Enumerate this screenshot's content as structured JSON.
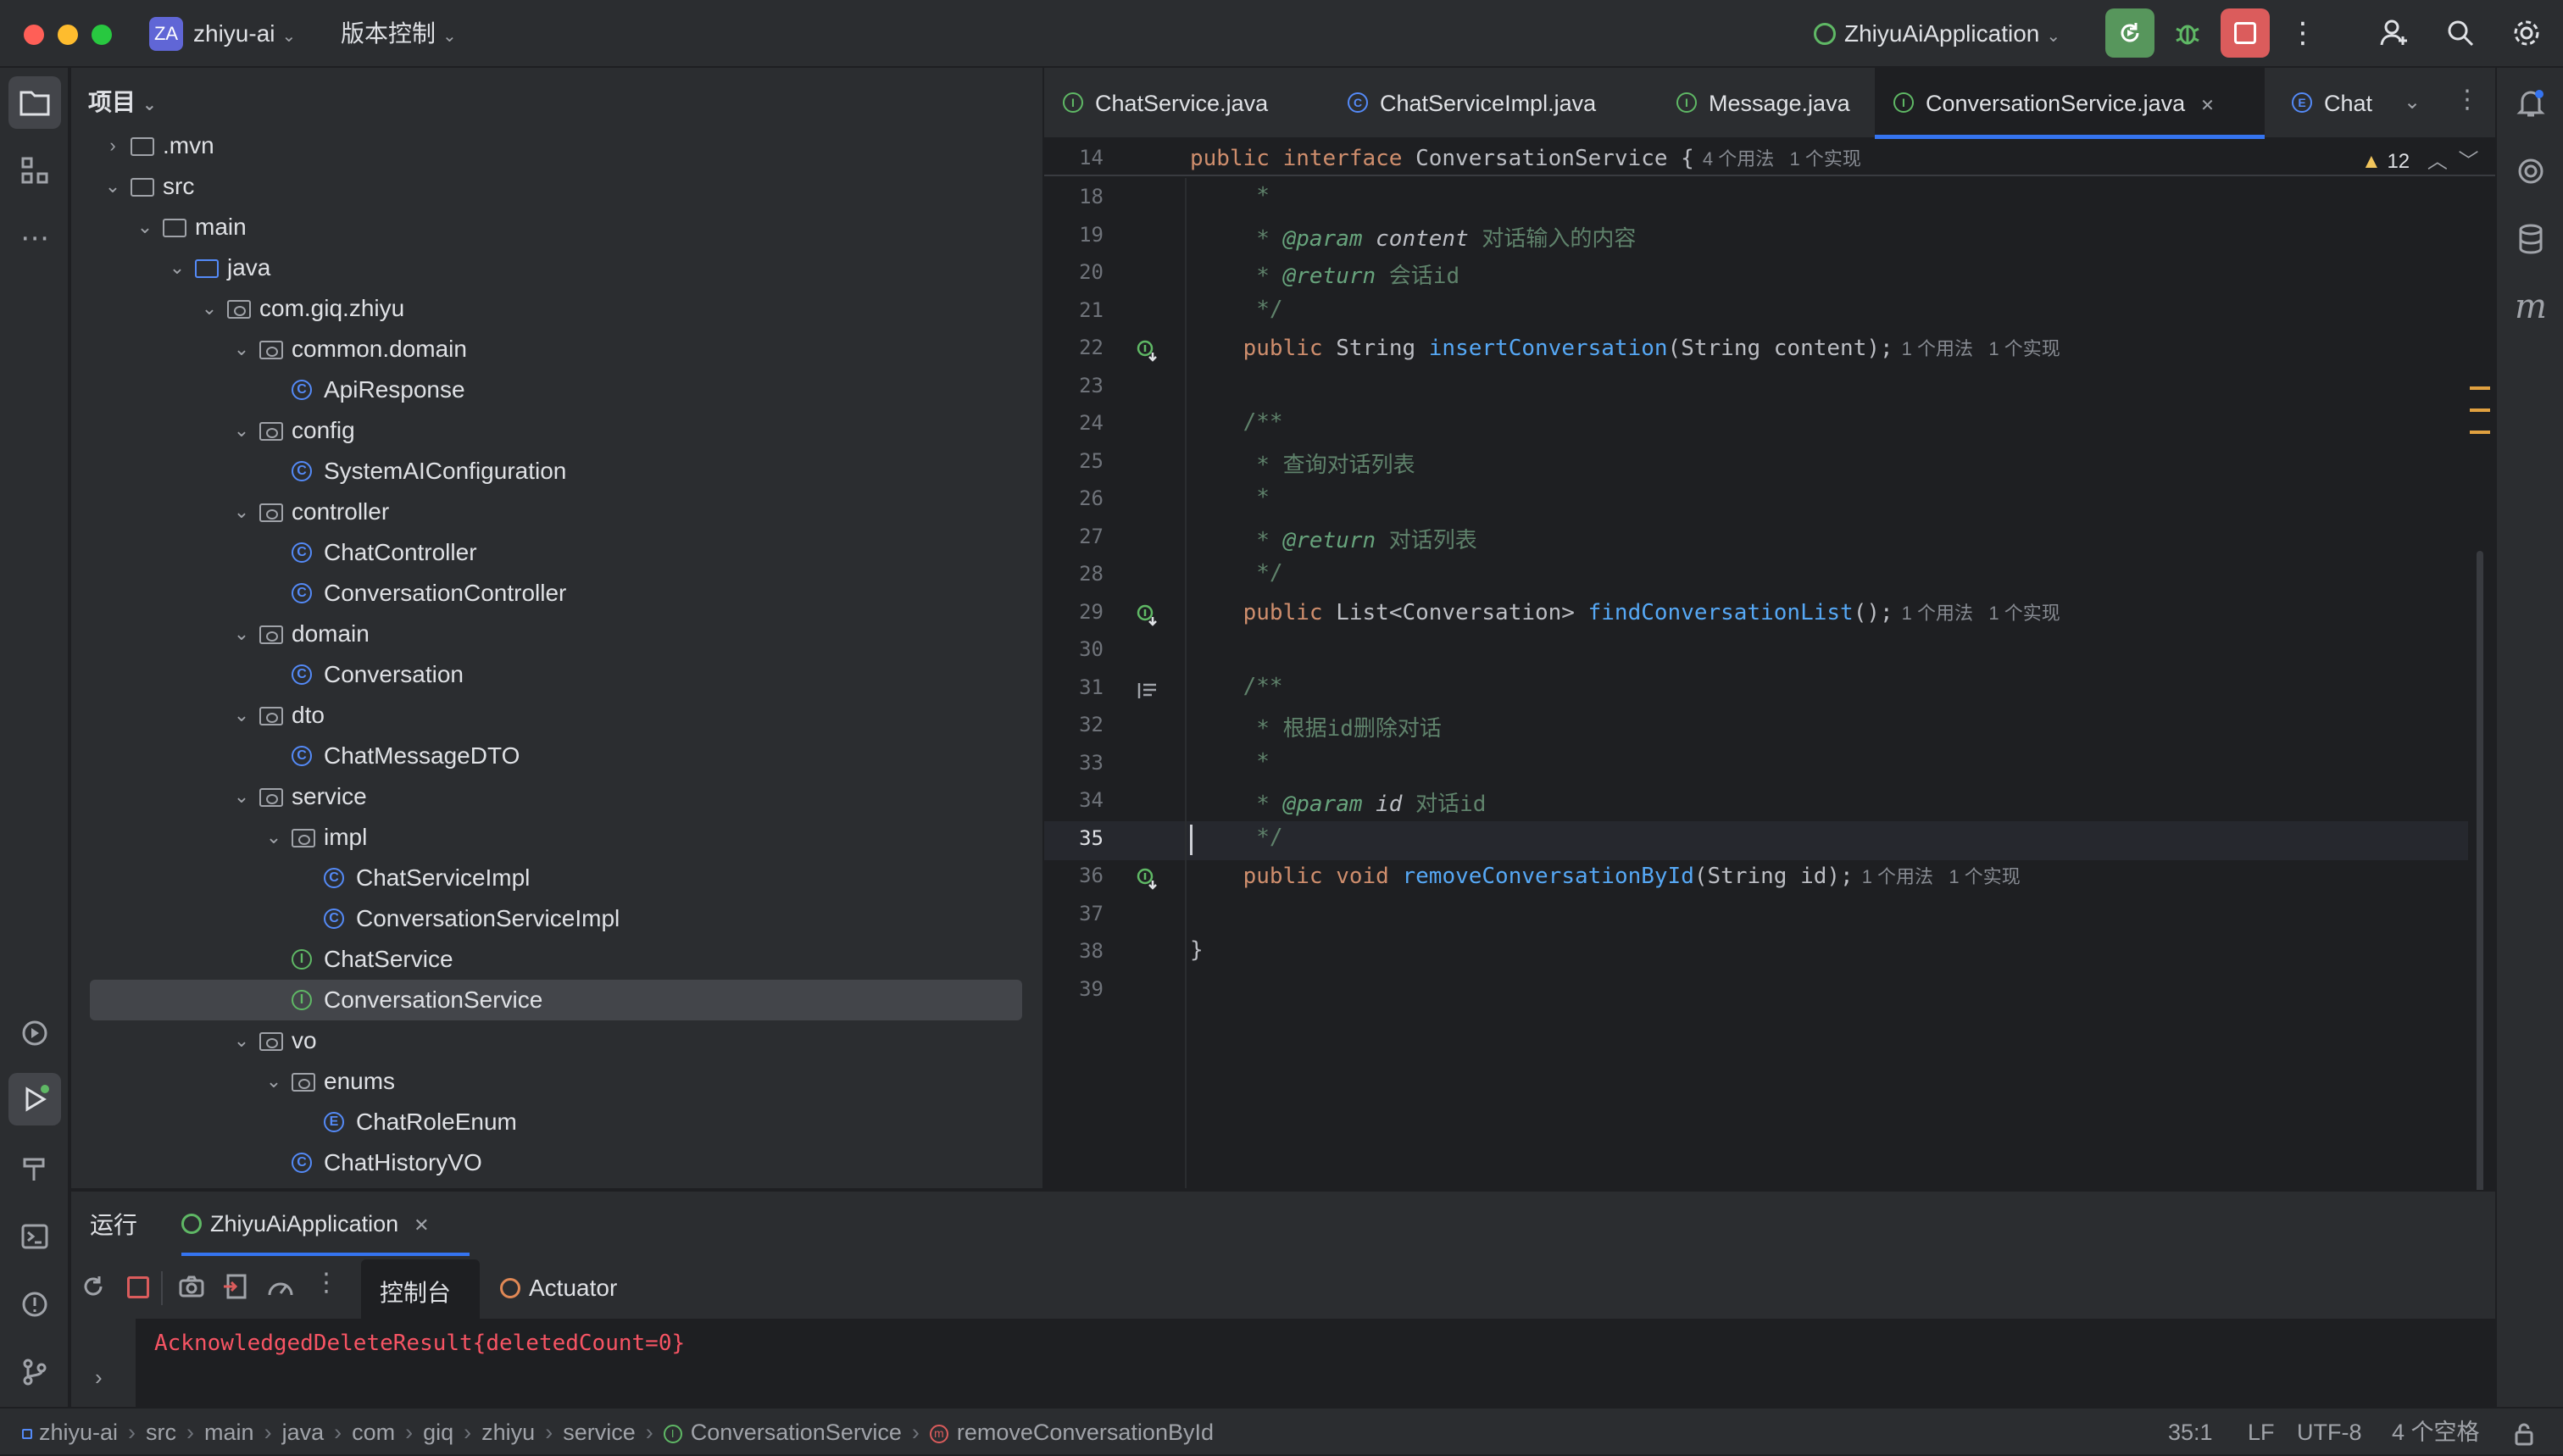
{
  "titlebar": {
    "project_badge": "ZA",
    "project_name": "zhiyu-ai",
    "vcs_menu": "版本控制",
    "run_config": "ZhiyuAiApplication",
    "colors": {
      "badge": "#6066d6",
      "rerun": "#57965c",
      "stop": "#db5c5c"
    }
  },
  "project_panel": {
    "title": "项目",
    "tree": [
      {
        "label": ".mvn",
        "depth": 1,
        "kind": "folder",
        "expanded": false
      },
      {
        "label": "src",
        "depth": 1,
        "kind": "folder",
        "expanded": true
      },
      {
        "label": "main",
        "depth": 2,
        "kind": "folder",
        "expanded": true
      },
      {
        "label": "java",
        "depth": 3,
        "kind": "source-folder",
        "expanded": true
      },
      {
        "label": "com.giq.zhiyu",
        "depth": 4,
        "kind": "package",
        "expanded": true
      },
      {
        "label": "common.domain",
        "depth": 5,
        "kind": "package",
        "expanded": true
      },
      {
        "label": "ApiResponse",
        "depth": 6,
        "kind": "class"
      },
      {
        "label": "config",
        "depth": 5,
        "kind": "package",
        "expanded": true
      },
      {
        "label": "SystemAIConfiguration",
        "depth": 6,
        "kind": "class"
      },
      {
        "label": "controller",
        "depth": 5,
        "kind": "package",
        "expanded": true
      },
      {
        "label": "ChatController",
        "depth": 6,
        "kind": "class"
      },
      {
        "label": "ConversationController",
        "depth": 6,
        "kind": "class"
      },
      {
        "label": "domain",
        "depth": 5,
        "kind": "package",
        "expanded": true
      },
      {
        "label": "Conversation",
        "depth": 6,
        "kind": "class"
      },
      {
        "label": "dto",
        "depth": 5,
        "kind": "package",
        "expanded": true
      },
      {
        "label": "ChatMessageDTO",
        "depth": 6,
        "kind": "class"
      },
      {
        "label": "service",
        "depth": 5,
        "kind": "package",
        "expanded": true
      },
      {
        "label": "impl",
        "depth": 6,
        "kind": "package",
        "expanded": true
      },
      {
        "label": "ChatServiceImpl",
        "depth": 7,
        "kind": "class"
      },
      {
        "label": "ConversationServiceImpl",
        "depth": 7,
        "kind": "class"
      },
      {
        "label": "ChatService",
        "depth": 6,
        "kind": "interface"
      },
      {
        "label": "ConversationService",
        "depth": 6,
        "kind": "interface",
        "selected": true
      },
      {
        "label": "vo",
        "depth": 5,
        "kind": "package",
        "expanded": true
      },
      {
        "label": "enums",
        "depth": 6,
        "kind": "package",
        "expanded": true
      },
      {
        "label": "ChatRoleEnum",
        "depth": 7,
        "kind": "enum"
      },
      {
        "label": "ChatHistoryVO",
        "depth": 6,
        "kind": "class"
      }
    ]
  },
  "editor": {
    "tabs": [
      {
        "label": "ChatService.java",
        "kind": "interface"
      },
      {
        "label": "ChatServiceImpl.java",
        "kind": "class"
      },
      {
        "label": "Message.java",
        "kind": "interface"
      },
      {
        "label": "ConversationService.java",
        "kind": "interface",
        "active": true
      },
      {
        "label": "Chat",
        "kind": "enum"
      }
    ],
    "sticky_line": {
      "num": "14",
      "text": "public interface ConversationService {",
      "hint": "4 个用法   1 个实现"
    },
    "warnings": "12",
    "lines": [
      {
        "num": "18",
        "t": "     *"
      },
      {
        "num": "19",
        "t": "     * @param content 对话输入的内容"
      },
      {
        "num": "20",
        "t": "     * @return 会话id"
      },
      {
        "num": "21",
        "t": "     */"
      },
      {
        "num": "22",
        "t": "    public String insertConversation(String content);",
        "hint": "1 个用法   1 个实现"
      },
      {
        "num": "23",
        "t": ""
      },
      {
        "num": "24",
        "t": "    /**"
      },
      {
        "num": "25",
        "t": "     * 查询对话列表"
      },
      {
        "num": "26",
        "t": "     *"
      },
      {
        "num": "27",
        "t": "     * @return 对话列表"
      },
      {
        "num": "28",
        "t": "     */"
      },
      {
        "num": "29",
        "t": "    public List<Conversation> findConversationList();",
        "hint": "1 个用法   1 个实现"
      },
      {
        "num": "30",
        "t": ""
      },
      {
        "num": "31",
        "t": "    /**"
      },
      {
        "num": "32",
        "t": "     * 根据id删除对话"
      },
      {
        "num": "33",
        "t": "     *"
      },
      {
        "num": "34",
        "t": "     * @param id 对话id"
      },
      {
        "num": "35",
        "t": "     */"
      },
      {
        "num": "36",
        "t": "    public void removeConversationById(String id);",
        "hint": "1 个用法   1 个实现"
      },
      {
        "num": "37",
        "t": ""
      },
      {
        "num": "38",
        "t": "}"
      },
      {
        "num": "39",
        "t": ""
      }
    ]
  },
  "run_panel": {
    "title": "运行",
    "run_tab": "ZhiyuAiApplication",
    "console_tab": "控制台",
    "actuator_tab": "Actuator",
    "output": "AcknowledgedDeleteResult{deletedCount=0}"
  },
  "statusbar": {
    "breadcrumbs": [
      "zhiyu-ai",
      "src",
      "main",
      "java",
      "com",
      "giq",
      "zhiyu",
      "service",
      "ConversationService",
      "removeConversationById"
    ],
    "position": "35:1",
    "line_ending": "LF",
    "encoding": "UTF-8",
    "indent": "4 个空格"
  }
}
